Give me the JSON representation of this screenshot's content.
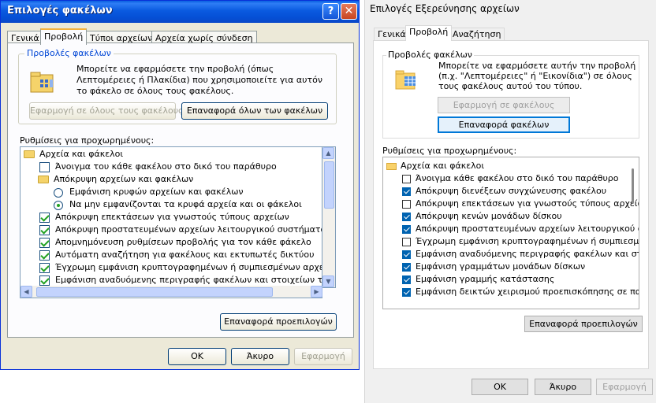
{
  "left": {
    "title": "Επιλογές φακέλων",
    "help_label": "?",
    "close_label": "✕",
    "tabs": [
      "Γενικά",
      "Προβολή",
      "Τύποι αρχείων",
      "Αρχεία χωρίς σύνδεση"
    ],
    "group_title": "Προβολές φακέλων",
    "description": "Μπορείτε να εφαρμόσετε την προβολή (όπως Λεπτομέρειες ή Πλακίδια) που χρησιμοποιείτε για αυτόν το φάκελο σε όλους τους φακέλους.",
    "apply_all": "Εφαρμογή σε όλους τους φακέλους",
    "reset_all": "Επαναφορά όλων των φακέλων",
    "advanced_label": "Ρυθμίσεις για προχωρημένους:",
    "tree": [
      {
        "type": "folder",
        "label": "Αρχεία και φάκελοι",
        "indent": 0
      },
      {
        "type": "checkbox",
        "label": "Άνοιγμα του κάθε φακέλου στο δικό του παράθυρο",
        "checked": false,
        "indent": 1
      },
      {
        "type": "folder",
        "label": "Απόκρυψη αρχείων και φακέλων",
        "indent": 1
      },
      {
        "type": "radio",
        "label": "Εμφάνιση κρυφών αρχείων και φακέλων",
        "checked": false,
        "indent": 2
      },
      {
        "type": "radio",
        "label": "Να μην εμφανίζονται τα κρυφά αρχεία και οι φάκελοι",
        "checked": true,
        "indent": 2
      },
      {
        "type": "checkbox",
        "label": "Απόκρυψη επεκτάσεων για γνωστούς τύπους αρχείων",
        "checked": true,
        "indent": 1
      },
      {
        "type": "checkbox",
        "label": "Απόκρυψη προστατευμένων αρχείων λειτουργικού συστήματος (πρ",
        "checked": true,
        "indent": 1
      },
      {
        "type": "checkbox",
        "label": "Απομνημόνευση ρυθμίσεων προβολής για τον κάθε φάκελο",
        "checked": true,
        "indent": 1
      },
      {
        "type": "checkbox",
        "label": "Αυτόματη αναζήτηση για φακέλους και εκτυπωτές δικτύου",
        "checked": true,
        "indent": 1
      },
      {
        "type": "checkbox",
        "label": "Έγχρωμη εμφάνιση κρυπτογραφημένων ή συμπιεσμένων αρχείων Ν",
        "checked": true,
        "indent": 1
      },
      {
        "type": "checkbox",
        "label": "Εμφάνιση αναδυόμενης περιγραφής φακέλων και στοιχείων της επ",
        "checked": true,
        "indent": 1
      }
    ],
    "restore_defaults": "Επαναφορά προεπιλογών",
    "ok": "OK",
    "cancel": "Άκυρο",
    "apply": "Εφαρμογή"
  },
  "right": {
    "title": "Επιλογές Εξερεύνησης αρχείων",
    "tabs": [
      "Γενικά",
      "Προβολή",
      "Αναζήτηση"
    ],
    "group_title": "Προβολές φακέλων",
    "description": "Μπορείτε να εφαρμόσετε αυτήν την προβολή (π.χ. \"Λεπτομέρειες\" ή \"Εικονίδια\") σε όλους τους φακέλους αυτού του τύπου.",
    "apply_folders": "Εφαρμογή σε φακέλους",
    "reset_folders": "Επαναφορά φακέλων",
    "advanced_label": "Ρυθμίσεις για προχωρημένους:",
    "tree": [
      {
        "type": "folder",
        "label": "Αρχεία και φάκελοι"
      },
      {
        "type": "checkbox",
        "label": "Άνοιγμα κάθε φακέλου στο δικό του παράθυρο",
        "checked": false
      },
      {
        "type": "checkbox",
        "label": "Απόκρυψη διενέξεων συγχώνευσης φακέλου",
        "checked": true
      },
      {
        "type": "checkbox",
        "label": "Απόκρυψη επεκτάσεων για γνωστούς τύπους αρχείων",
        "checked": false
      },
      {
        "type": "checkbox",
        "label": "Απόκρυψη κενών μονάδων δίσκου",
        "checked": true
      },
      {
        "type": "checkbox",
        "label": "Απόκρυψη προστατευμένων αρχείων λειτουργικού συ",
        "checked": true
      },
      {
        "type": "checkbox",
        "label": "Έγχρωμη εμφάνιση κρυπτογραφημένων ή συμπιεσμέ",
        "checked": false
      },
      {
        "type": "checkbox",
        "label": "Εμφάνιση αναδυόμενης περιγραφής φακέλων και στο",
        "checked": true
      },
      {
        "type": "checkbox",
        "label": "Εμφάνιση γραμμάτων μονάδων δίσκων",
        "checked": true
      },
      {
        "type": "checkbox",
        "label": "Εμφάνιση γραμμής κατάστασης",
        "checked": true
      },
      {
        "type": "checkbox",
        "label": "Εμφάνιση δεικτών χειρισμού προεπισκόπησης σε παρά",
        "checked": true
      }
    ],
    "restore_defaults": "Επαναφορά προεπιλογών",
    "ok": "OK",
    "cancel": "Άκυρο",
    "apply": "Εφαρμογή"
  }
}
